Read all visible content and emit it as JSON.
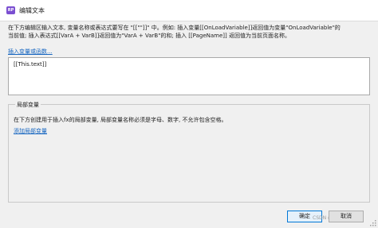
{
  "window": {
    "icon_text": "RP",
    "title": "编辑文本"
  },
  "description": {
    "line1": "在下方编辑区输入文本, 变量名称或表达式要写在 \"[[\"\"]]\" 中。例如: 插入变量[[OnLoadVariable]]返回值为变量\"OnLoadVariable\"的",
    "line2": "当前值; 插入表达式[[VarA + VarB]]返回值为\"VarA + VarB\"的和; 插入 [[PageName]] 返回值为当前页面名称。"
  },
  "insert_link": "插入变量或函数...",
  "editor_value": "[[This.text]]",
  "local_vars": {
    "legend": "局部变量",
    "description": "在下方创建用于插入fx的局部变量, 局部变量名称必须是字母、数字, 不允许包含空格。",
    "add_link": "添加局部变量"
  },
  "buttons": {
    "ok": "确定",
    "cancel": "取消"
  },
  "watermark": "CSDN @Andy_Lin"
}
